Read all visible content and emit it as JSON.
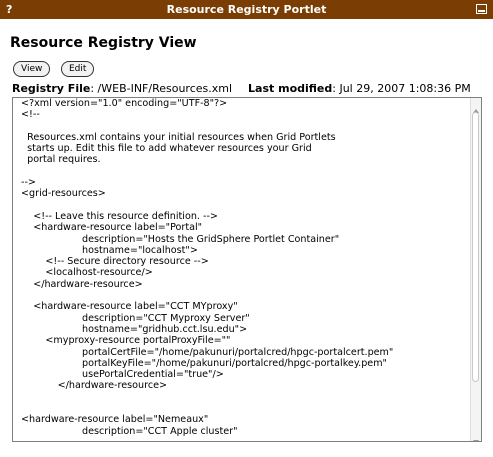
{
  "titlebar": {
    "help_label": "?",
    "title": "Resource Registry Portlet",
    "minimize_icon": "minimize-icon",
    "color": "#7a3e04"
  },
  "page": {
    "heading": "Resource Registry View"
  },
  "buttons": {
    "view_label": "View",
    "edit_label": "Edit"
  },
  "fileinfo": {
    "registry_label": "Registry File",
    "registry_value": ": /WEB-INF/Resources.xml",
    "modified_label": "Last modified",
    "modified_value": ": Jul 29, 2007 1:08:36 PM"
  },
  "editor": {
    "content": "<?xml version=\"1.0\" encoding=\"UTF-8\"?>\n<!--\n\n  Resources.xml contains your initial resources when Grid Portlets\n  starts up. Edit this file to add whatever resources your Grid\n  portal requires.\n\n-->\n<grid-resources>\n\n    <!-- Leave this resource definition. -->\n    <hardware-resource label=\"Portal\"\n                    description=\"Hosts the GridSphere Portlet Container\"\n                    hostname=\"localhost\">\n        <!-- Secure directory resource -->\n        <localhost-resource/>\n    </hardware-resource>\n\n    <hardware-resource label=\"CCT MYproxy\"\n                    description=\"CCT Myproxy Server\"\n                    hostname=\"gridhub.cct.lsu.edu\">\n        <myproxy-resource portalProxyFile=\"\"\n                    portalCertFile=\"/home/pakunuri/portalcred/hpgc-portalcert.pem\"\n                    portalKeyFile=\"/home/pakunuri/portalcred/hpgc-portalkey.pem\"\n                    usePortalCredential=\"true\"/>\n            </hardware-resource>\n\n\n<hardware-resource label=\"Nemeaux\"\n                    description=\"CCT Apple cluster\"",
    "scroll_up_icon": "scroll-up-icon",
    "scroll_down_icon": "scroll-down-icon"
  }
}
